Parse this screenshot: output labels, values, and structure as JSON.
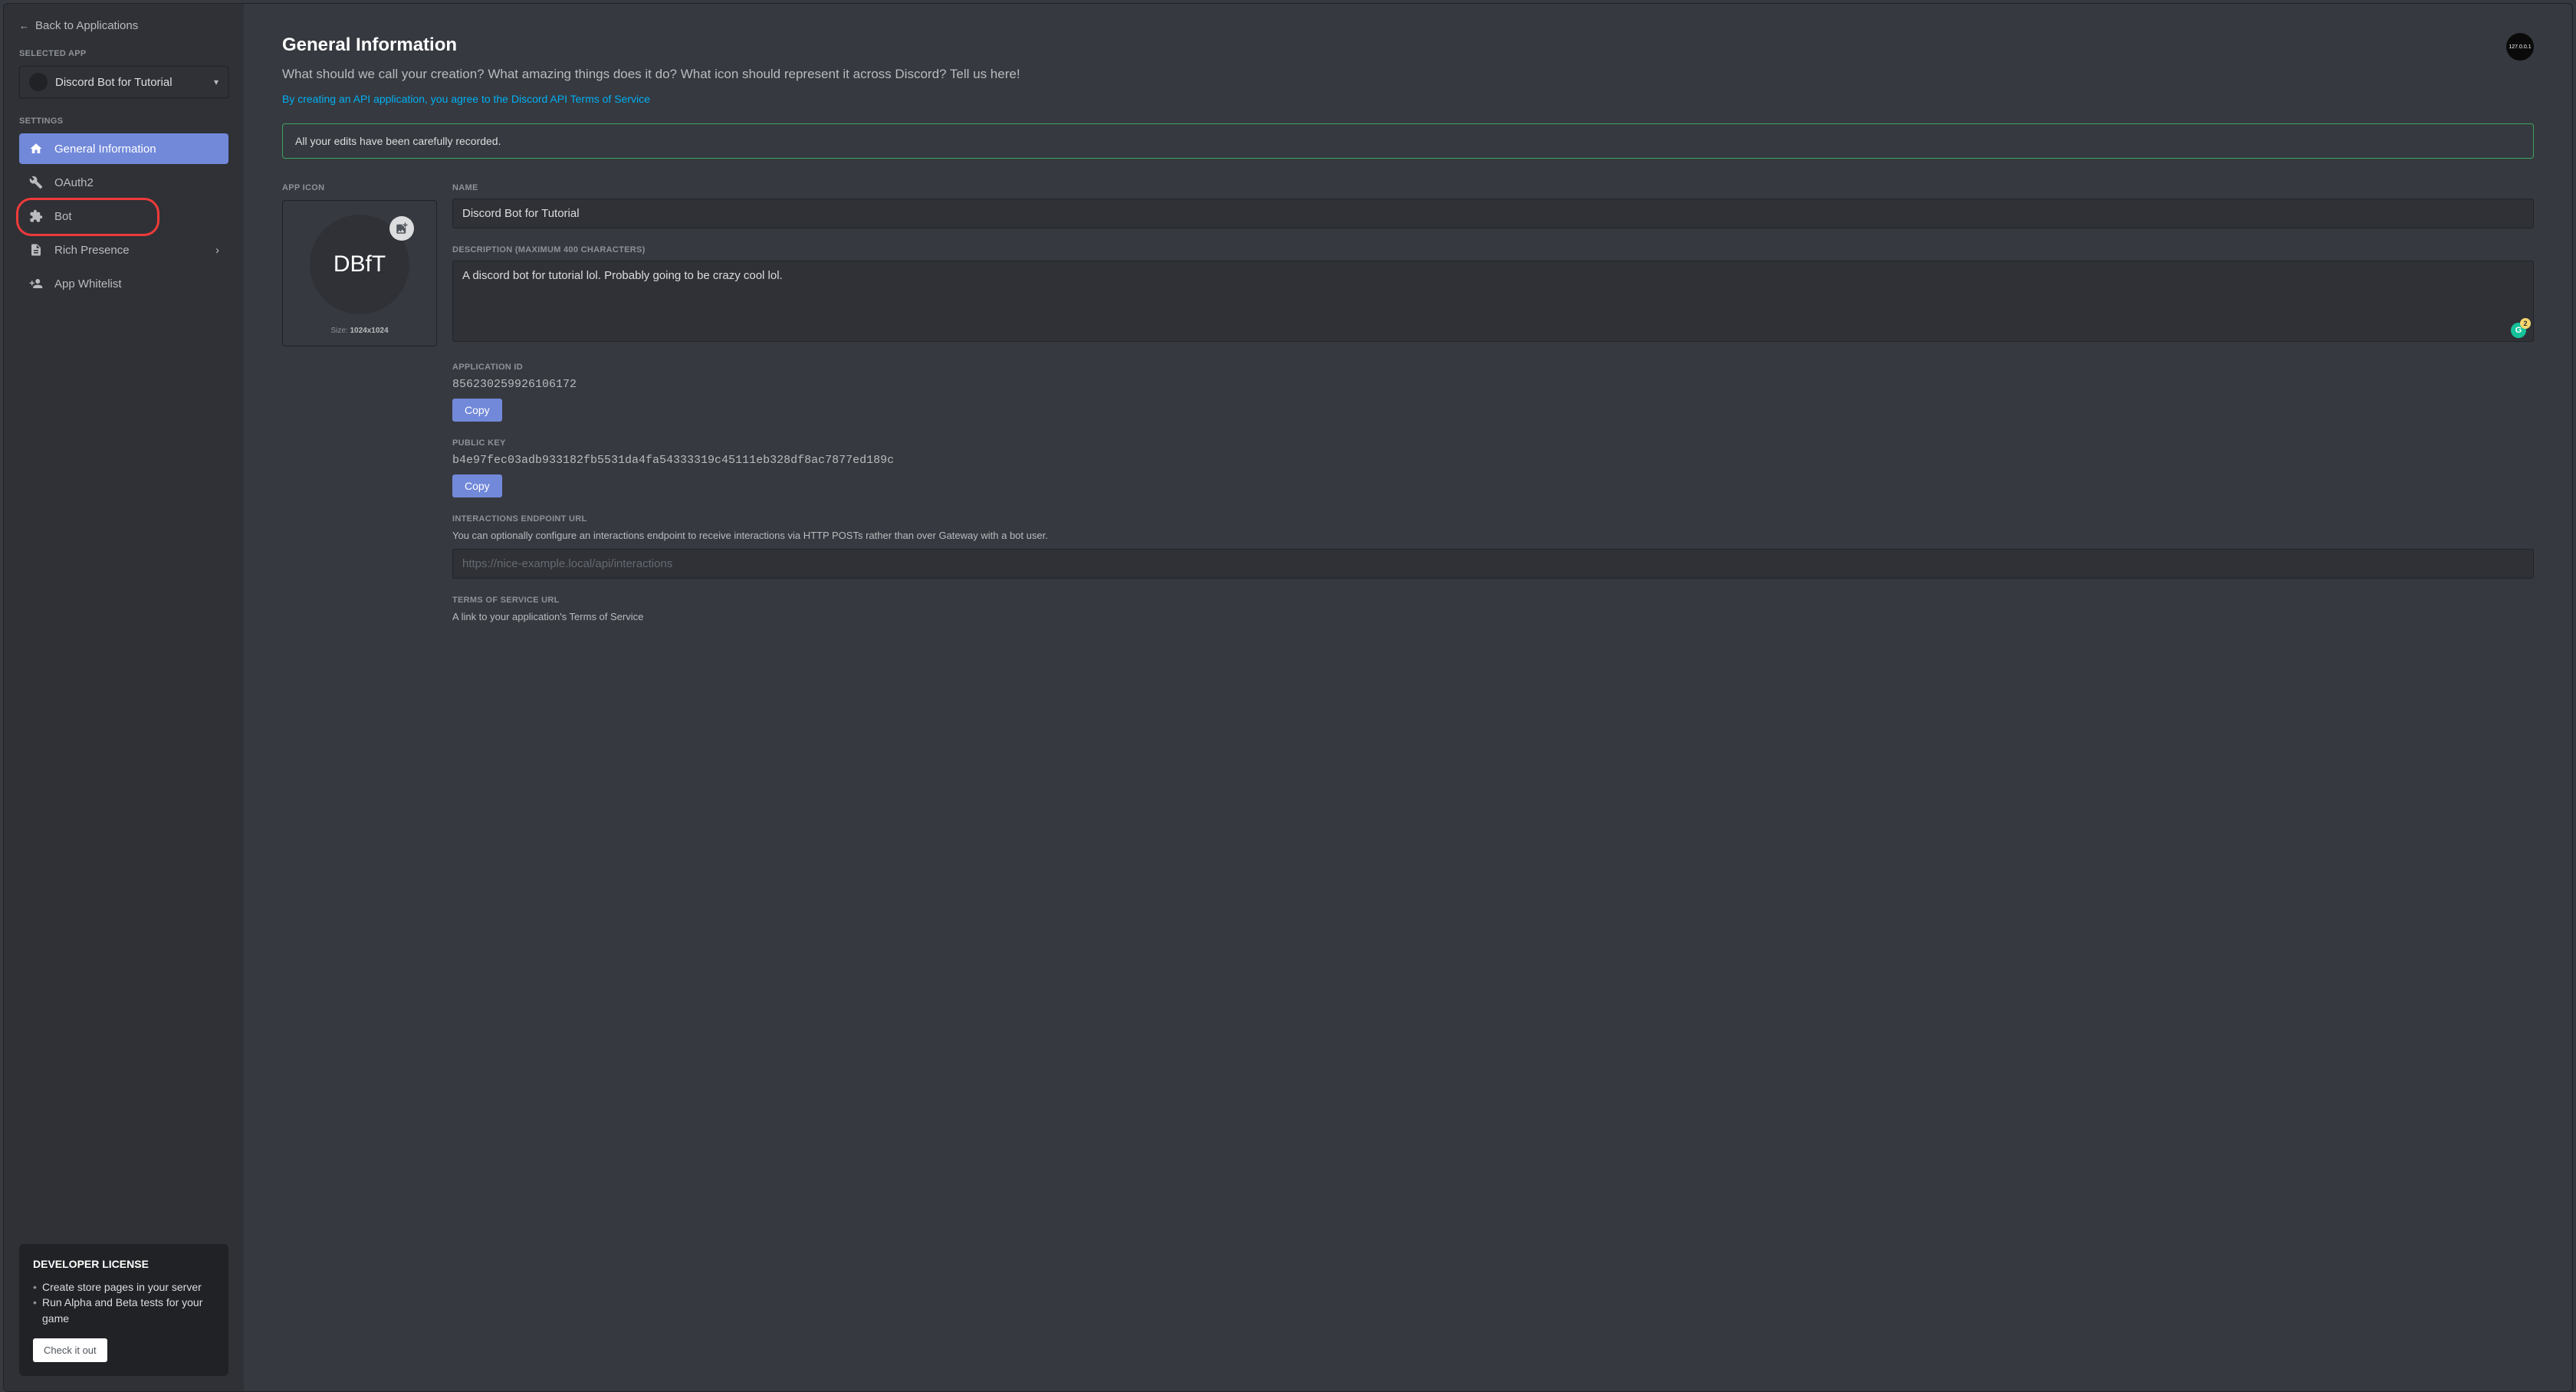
{
  "sidebar": {
    "back_label": "Back to Applications",
    "selected_app_label": "SELECTED APP",
    "selected_app_name": "Discord Bot for Tutorial",
    "settings_label": "SETTINGS",
    "nav": [
      {
        "label": "General Information",
        "icon": "home"
      },
      {
        "label": "OAuth2",
        "icon": "wrench"
      },
      {
        "label": "Bot",
        "icon": "puzzle"
      },
      {
        "label": "Rich Presence",
        "icon": "page"
      },
      {
        "label": "App Whitelist",
        "icon": "person"
      }
    ],
    "dev_license": {
      "title": "DEVELOPER LICENSE",
      "bullets": [
        "Create store pages in your server",
        "Run Alpha and Beta tests for your game"
      ],
      "cta": "Check it out"
    }
  },
  "main": {
    "title": "General Information",
    "subtitle": "What should we call your creation? What amazing things does it do? What icon should represent it across Discord? Tell us here!",
    "tos_text": "By creating an API application, you agree to the Discord API Terms of Service",
    "notice": "All your edits have been carefully recorded.",
    "app_icon_label": "APP ICON",
    "app_icon_initials": "DBfT",
    "app_icon_size_label": "Size:",
    "app_icon_size_value": "1024x1024",
    "name_label": "NAME",
    "name_value": "Discord Bot for Tutorial",
    "desc_label": "DESCRIPTION (MAXIMUM 400 CHARACTERS)",
    "desc_value": "A discord bot for tutorial lol. Probably going to be crazy cool lol.",
    "grammarly_count": "2",
    "app_id_label": "APPLICATION ID",
    "app_id_value": "856230259926106172",
    "public_key_label": "PUBLIC KEY",
    "public_key_value": "b4e97fec03adb933182fb5531da4fa54333319c45111eb328df8ac7877ed189c",
    "copy_label": "Copy",
    "interactions_label": "INTERACTIONS ENDPOINT URL",
    "interactions_help": "You can optionally configure an interactions endpoint to receive interactions via HTTP POSTs rather than over Gateway with a bot user.",
    "interactions_placeholder": "https://nice-example.local/api/interactions",
    "tos_url_label": "TERMS OF SERVICE URL",
    "tos_url_help": "A link to your application's Terms of Service",
    "brand_badge_text": "127.0.0.1"
  }
}
